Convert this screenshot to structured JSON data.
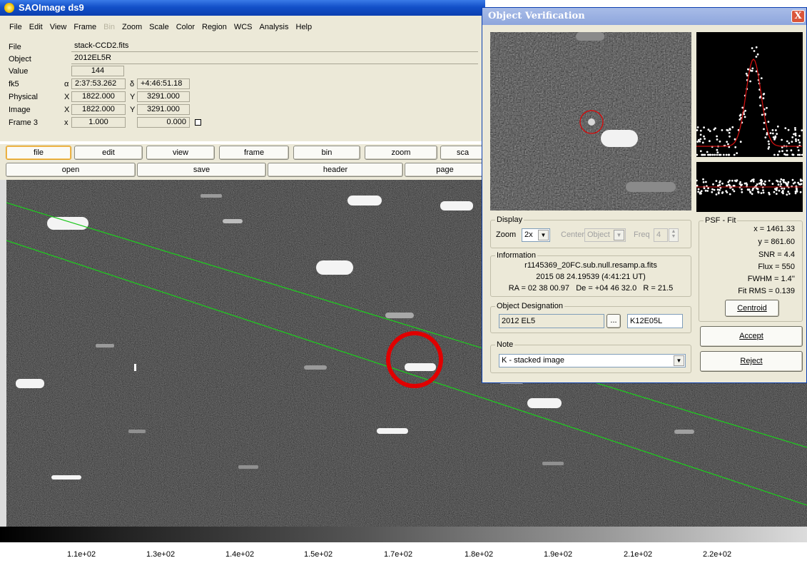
{
  "ds9": {
    "title": "SAOImage ds9",
    "menu": [
      {
        "label": "File",
        "enabled": true
      },
      {
        "label": "Edit",
        "enabled": true
      },
      {
        "label": "View",
        "enabled": true
      },
      {
        "label": "Frame",
        "enabled": true
      },
      {
        "label": "Bin",
        "enabled": false
      },
      {
        "label": "Zoom",
        "enabled": true
      },
      {
        "label": "Scale",
        "enabled": true
      },
      {
        "label": "Color",
        "enabled": true
      },
      {
        "label": "Region",
        "enabled": true
      },
      {
        "label": "WCS",
        "enabled": true
      },
      {
        "label": "Analysis",
        "enabled": true
      },
      {
        "label": "Help",
        "enabled": true
      }
    ],
    "info": {
      "file_label": "File",
      "file_value": "stack-CCD2.fits",
      "object_label": "Object",
      "object_value": "2012EL5R",
      "value_label": "Value",
      "value_value": "144",
      "fk5_label": "fk5",
      "alpha_sym": "α",
      "alpha_value": "2:37:53.262",
      "delta_sym": "δ",
      "delta_value": "+4:46:51.18",
      "physical_label": "Physical",
      "physical_x_sym": "X",
      "physical_x": "1822.000",
      "physical_y_sym": "Y",
      "physical_y": "3291.000",
      "image_label": "Image",
      "image_x_sym": "X",
      "image_x": "1822.000",
      "image_y_sym": "Y",
      "image_y": "3291.000",
      "frame_label": "Frame 3",
      "frame_x_sym": "x",
      "frame_zoom": "1.000",
      "frame_angle": "0.000"
    },
    "buttons_row1": [
      "file",
      "edit",
      "view",
      "frame",
      "bin",
      "zoom",
      "sca"
    ],
    "buttons_row2": [
      "open",
      "save",
      "header",
      "page"
    ],
    "colorbar_ticks": [
      "1.1e+02",
      "1.3e+02",
      "1.4e+02",
      "1.5e+02",
      "1.7e+02",
      "1.8e+02",
      "1.9e+02",
      "2.1e+02",
      "2.2e+02"
    ]
  },
  "verification": {
    "title": "Object Verification",
    "close_label": "X",
    "display_group": "Display",
    "zoom_label": "Zoom",
    "zoom_value": "2x",
    "center_label": "Center",
    "center_value": "Object",
    "freq_label": "Freq",
    "freq_value": "4",
    "info_group": "Information",
    "info_file": "r1145369_20FC.sub.null.resamp.a.fits",
    "info_date": "2015 08 24.19539 (4:41:21 UT)",
    "info_coords": "RA = 02 38 00.97   De = +04 46 32.0   R = 21.5",
    "designation_group": "Object Designation",
    "designation_value": "2012 EL5",
    "designation_browse": "...",
    "designation_code": "K12E05L",
    "note_group": "Note",
    "note_value": "K - stacked image",
    "psf_group": "PSF - Fit",
    "psf_x": "x = 1461.33",
    "psf_y": "y = 861.60",
    "psf_snr": "SNR = 4.4",
    "psf_flux": "Flux = 550",
    "psf_fwhm": "FWHM = 1.4''",
    "psf_rms": "Fit RMS = 0.139",
    "centroid_label": "Centroid",
    "accept_label": "Accept",
    "reject_label": "Reject"
  },
  "colors": {
    "accent": "#0b3fb0",
    "window": "#ece9d8",
    "track_line": "#1fc81f",
    "marker": "#e00000",
    "fit_curve": "#d01010"
  }
}
